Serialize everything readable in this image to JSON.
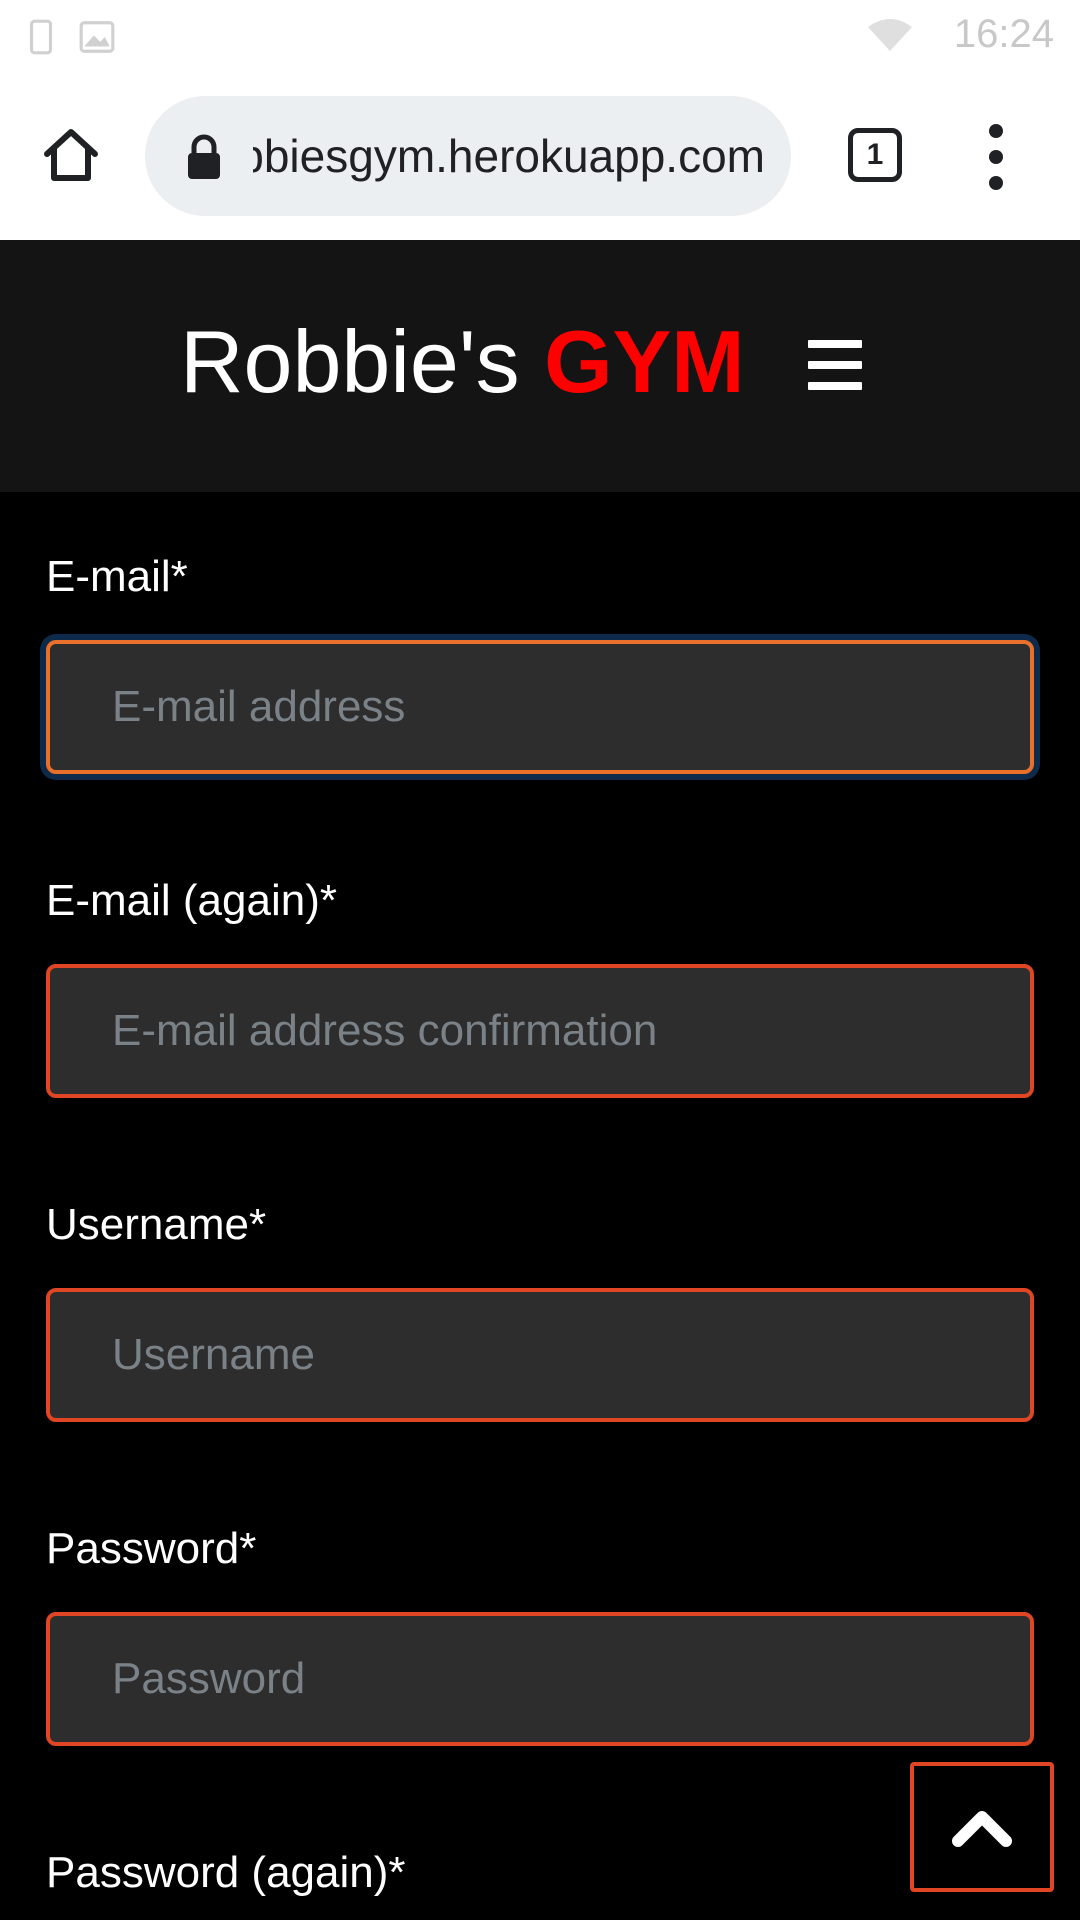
{
  "status_bar": {
    "time": "16:24",
    "icons": [
      "notification-icon",
      "image-icon",
      "wifi-icon"
    ]
  },
  "browser": {
    "url": "robbiesgym.herokuapp.com",
    "tab_count": "1",
    "icons": [
      "home-icon",
      "lock-icon",
      "tab-switcher-icon",
      "more-vert-icon"
    ]
  },
  "header": {
    "brand_name": "Robbie's",
    "brand_accent": "GYM",
    "accent_color": "#ff0000",
    "menu_icon": "hamburger-icon"
  },
  "form": {
    "fields": [
      {
        "label": "E-mail*",
        "placeholder": "E-mail address",
        "value": ""
      },
      {
        "label": "E-mail (again)*",
        "placeholder": "E-mail address confirmation",
        "value": ""
      },
      {
        "label": "Username*",
        "placeholder": "Username",
        "value": ""
      },
      {
        "label": "Password*",
        "placeholder": "Password",
        "value": ""
      },
      {
        "label": "Password (again)*"
      }
    ],
    "error_border_color": "#e04624",
    "focus_border_color": "#e8702a"
  },
  "back_to_top": {
    "icon": "chevron-up-icon"
  }
}
